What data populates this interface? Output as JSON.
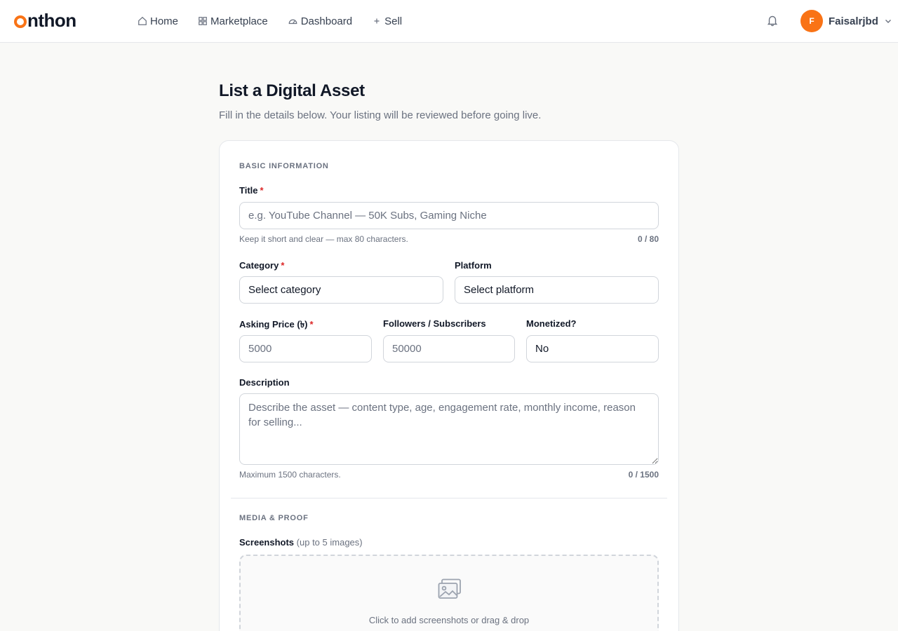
{
  "brand": {
    "logo_rest": "nthon",
    "accent": "#f97316"
  },
  "nav": {
    "items": [
      {
        "label": "Home",
        "icon": "home-icon"
      },
      {
        "label": "Marketplace",
        "icon": "grid-icon"
      },
      {
        "label": "Dashboard",
        "icon": "gauge-icon"
      },
      {
        "label": "Sell",
        "icon": "plus-icon"
      }
    ]
  },
  "user": {
    "initial": "F",
    "name": "Faisalrjbd"
  },
  "page": {
    "title": "List a Digital Asset",
    "subtitle": "Fill in the details below. Your listing will be reviewed before going live."
  },
  "basic": {
    "section": "BASIC INFORMATION",
    "title_label": "Title",
    "title_placeholder": "e.g. YouTube Channel — 50K Subs, Gaming Niche",
    "title_value": "",
    "title_hint": "Keep it short and clear — max 80 characters.",
    "title_counter": "0 / 80",
    "category_label": "Category",
    "category_value": "Select category",
    "platform_label": "Platform",
    "platform_value": "Select platform",
    "price_label": "Asking Price (৳)",
    "price_placeholder": "5000",
    "followers_label": "Followers / Subscribers",
    "followers_placeholder": "50000",
    "monetized_label": "Monetized?",
    "monetized_value": "No",
    "description_label": "Description",
    "description_placeholder": "Describe the asset — content type, age, engagement rate, monthly income, reason for selling...",
    "description_hint": "Maximum 1500 characters.",
    "description_counter": "0 / 1500",
    "required_mark": "*"
  },
  "media": {
    "section": "MEDIA & PROOF",
    "screenshots_label": "Screenshots",
    "screenshots_note": "(up to 5 images)",
    "dropzone_text": "Click to add screenshots or drag & drop",
    "dropzone_icon": "image-icon"
  }
}
